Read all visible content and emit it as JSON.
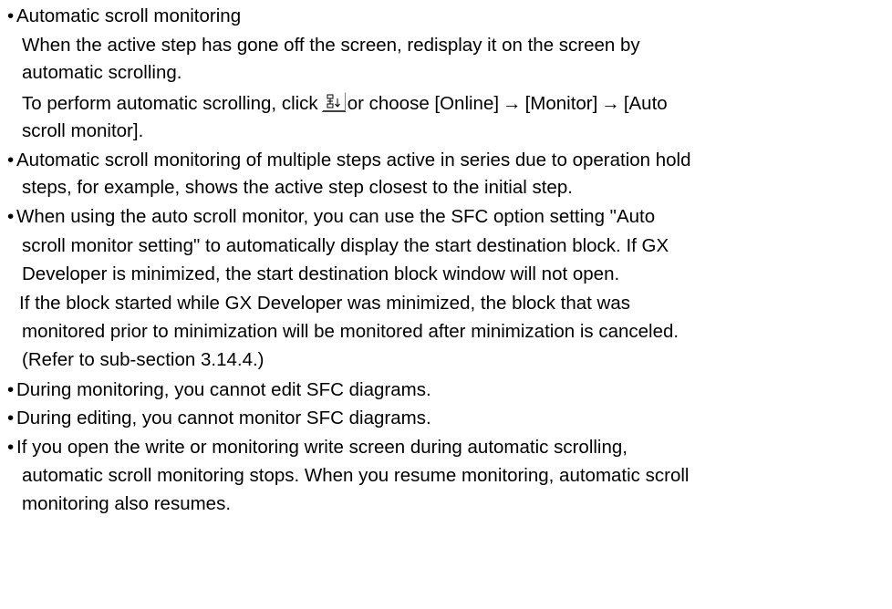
{
  "bullet_glyph": "•",
  "arrow_glyph": "→",
  "sections": {
    "auto_scroll": {
      "heading": "Automatic scroll monitoring",
      "line1": "When the active step has gone off the screen, redisplay it on the screen by",
      "line2": "automatic scrolling.",
      "line3_before": "To perform automatic scrolling, click",
      "line3_after": "or choose [Online]",
      "menu_monitor": "[Monitor]",
      "menu_auto": "[Auto",
      "line4": "scroll monitor]."
    },
    "multiple_steps": {
      "line1": "Automatic scroll monitoring of multiple steps active in series due to operation hold",
      "line2": "steps, for example, shows the active step closest to the initial step."
    },
    "sfc_option": {
      "line1": "When using the auto scroll monitor, you can use the SFC option setting \"Auto",
      "line2": "scroll monitor setting\" to automatically display the start destination block.  If GX",
      "line3": "Developer is minimized, the start destination block window will not open.",
      "line4": "If the block started while GX Developer was minimized, the block that was",
      "line5": "monitored prior to minimization will be monitored after minimization is canceled.",
      "line6": "(Refer to sub-section 3.14.4.)"
    },
    "during_monitoring": {
      "line1": "During monitoring, you cannot edit SFC diagrams."
    },
    "during_editing": {
      "line1": "During editing, you cannot monitor SFC diagrams."
    },
    "write_screen": {
      "line1": "If you open the write or monitoring write screen during automatic scrolling,",
      "line2": "automatic scroll monitoring stops. When you resume monitoring, automatic scroll",
      "line3": "monitoring also resumes."
    }
  },
  "icons": {
    "auto_scroll_button": "auto-scroll-monitor-icon"
  }
}
